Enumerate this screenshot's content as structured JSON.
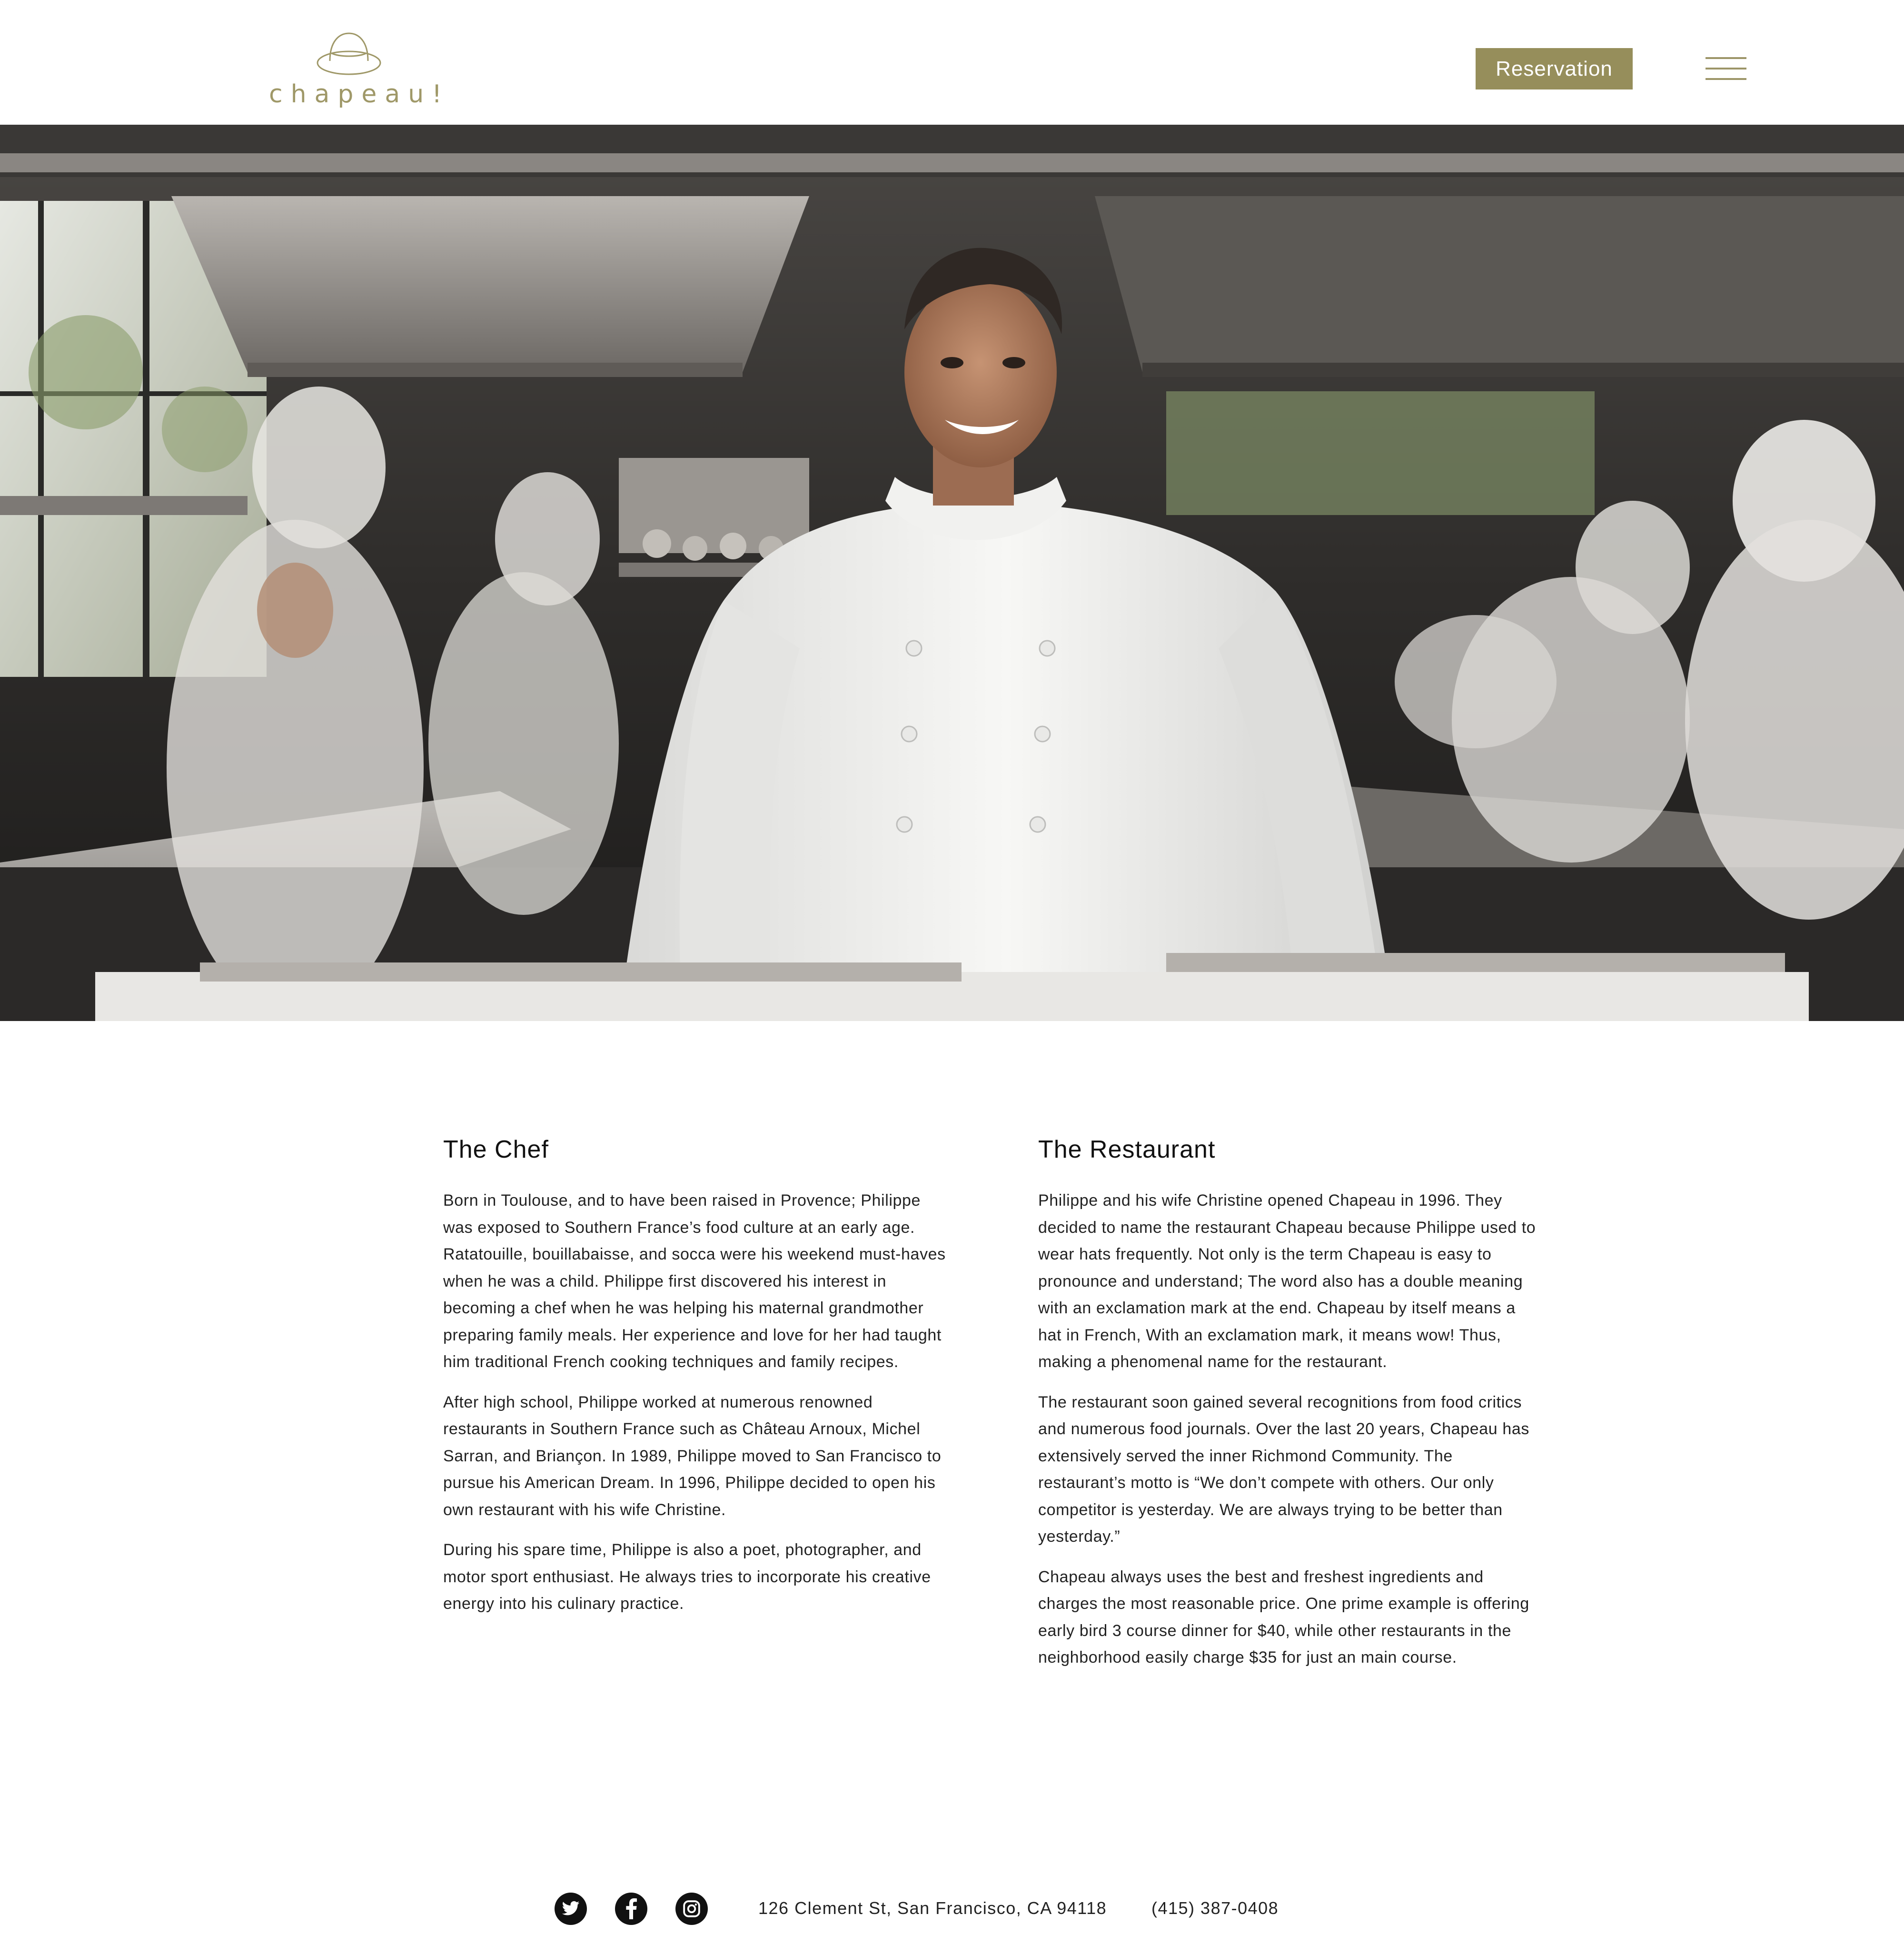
{
  "header": {
    "logo_text": "chapeau!",
    "reservation_label": "Reservation",
    "menu_icon": "hamburger-menu-icon",
    "accent_color": "#968e5b"
  },
  "hero": {
    "image": "chef-in-kitchen-photo"
  },
  "chef": {
    "heading": "The Chef",
    "paragraphs": [
      "Born in Toulouse, and to have been raised in Provence; Philippe was exposed to Southern France’s food culture at an early age. Ratatouille, bouillabaisse, and socca were his weekend must-haves when he was a child. Philippe first discovered his interest in becoming a chef when he was helping his maternal grandmother preparing family meals. Her experience and love for her had taught him traditional French cooking techniques and family recipes.",
      "After high school, Philippe worked at numerous renowned restaurants in Southern France such as Château Arnoux, Michel Sarran, and Briançon. In 1989, Philippe moved to San Francisco to pursue his American Dream. In 1996, Philippe decided to open his own restaurant with his wife Christine.",
      "During his spare time, Philippe is also a poet, photographer, and motor sport enthusiast. He always tries to incorporate his creative energy into his culinary practice."
    ]
  },
  "restaurant": {
    "heading": "The Restaurant",
    "paragraphs": [
      "Philippe and his wife Christine opened Chapeau in 1996. They decided to name the restaurant Chapeau because Philippe used to wear hats frequently. Not only is the term Chapeau is easy to pronounce and understand; The word also has a double meaning with an exclamation mark at the end. Chapeau by itself means a hat in French, With an exclamation mark, it means wow! Thus, making a phenomenal name for the restaurant.",
      "The restaurant soon gained several recognitions from food critics and numerous food journals. Over the last 20 years, Chapeau has extensively served the inner Richmond Community. The restaurant’s motto is “We don’t compete with others. Our only competitor is yesterday. We are always trying to be better than yesterday.”",
      "Chapeau always uses the best and freshest ingredients and charges the most reasonable price. One prime example is offering early bird 3 course dinner for $40, while other restaurants in the neighborhood easily charge $35 for just an main course."
    ]
  },
  "footer": {
    "social_icons": [
      "twitter-icon",
      "facebook-icon",
      "instagram-icon"
    ],
    "address": "126 Clement St, San Francisco, CA 94118",
    "phone": "(415) 387-0408"
  }
}
